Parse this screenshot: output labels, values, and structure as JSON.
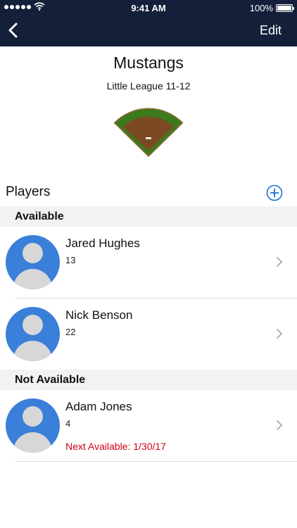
{
  "status_bar": {
    "time": "9:41 AM",
    "battery_pct": "100%",
    "battery_level": 1.0
  },
  "nav": {
    "edit_label": "Edit",
    "back_icon": "chevron-left-icon"
  },
  "team": {
    "name": "Mustangs",
    "league": "Little League 11-12"
  },
  "players_section": {
    "title": "Players",
    "add_icon": "plus-circle-icon"
  },
  "groups": [
    {
      "label": "Available",
      "players": [
        {
          "name": "Jared Hughes",
          "number": "13"
        },
        {
          "name": "Nick Benson",
          "number": "22"
        }
      ]
    },
    {
      "label": "Not Available",
      "players": [
        {
          "name": "Adam Jones",
          "number": "4",
          "note": "Next Available: 1/30/17"
        }
      ]
    }
  ],
  "colors": {
    "nav_bar": "#14203a",
    "accent": "#1a6fd1",
    "avatar": "#3a7fd9",
    "unavailable_note": "#d0021b",
    "outfield": "#3c7a1e",
    "infield": "#7b4a22"
  }
}
